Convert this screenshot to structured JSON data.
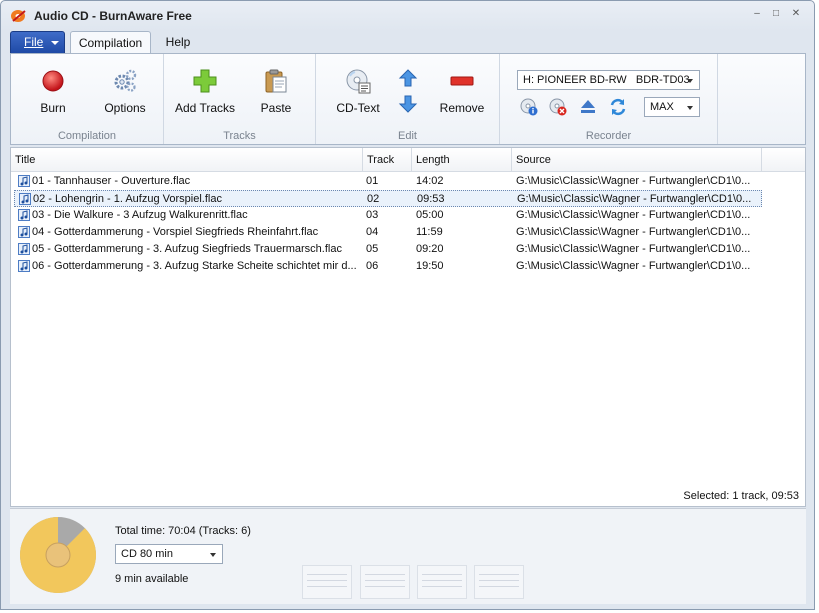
{
  "window": {
    "title": "Audio CD - BurnAware Free"
  },
  "tabs": {
    "file": "File",
    "items": [
      "Compilation",
      "Help"
    ]
  },
  "ribbon": {
    "groups": {
      "compilation": {
        "label": "Compilation",
        "burn": "Burn",
        "options": "Options"
      },
      "tracks": {
        "label": "Tracks",
        "add": "Add Tracks",
        "paste": "Paste"
      },
      "edit": {
        "label": "Edit",
        "cdtext": "CD-Text",
        "remove": "Remove"
      },
      "recorder": {
        "label": "Recorder",
        "drive": "H: PIONEER BD-RW   BDR-TD03",
        "speed": "MAX"
      }
    }
  },
  "columns": {
    "title": "Title",
    "track": "Track",
    "length": "Length",
    "source": "Source"
  },
  "rows": [
    {
      "title": "01 - Tannhauser - Ouverture.flac",
      "track": "01",
      "length": "14:02",
      "source": "G:\\Music\\Classic\\Wagner - Furtwangler\\CD1\\0..."
    },
    {
      "title": "02 - Lohengrin - 1. Aufzug Vorspiel.flac",
      "track": "02",
      "length": "09:53",
      "source": "G:\\Music\\Classic\\Wagner - Furtwangler\\CD1\\0..."
    },
    {
      "title": "03 - Die Walkure - 3 Aufzug Walkurenritt.flac",
      "track": "03",
      "length": "05:00",
      "source": "G:\\Music\\Classic\\Wagner - Furtwangler\\CD1\\0..."
    },
    {
      "title": "04 - Gotterdammerung - Vorspiel Siegfrieds Rheinfahrt.flac",
      "track": "04",
      "length": "11:59",
      "source": "G:\\Music\\Classic\\Wagner - Furtwangler\\CD1\\0..."
    },
    {
      "title": "05 - Gotterdammerung - 3. Aufzug Siegfrieds Trauermarsch.flac",
      "track": "05",
      "length": "09:20",
      "source": "G:\\Music\\Classic\\Wagner - Furtwangler\\CD1\\0..."
    },
    {
      "title": "06 - Gotterdammerung - 3. Aufzug Starke Scheite schichtet mir d...",
      "track": "06",
      "length": "19:50",
      "source": "G:\\Music\\Classic\\Wagner - Furtwangler\\CD1\\0..."
    }
  ],
  "selected_row": 1,
  "status": {
    "selected": "Selected: 1 track, 09:53"
  },
  "summary": {
    "total": "Total time: 70:04 (Tracks: 6)",
    "disc": "CD 80 min",
    "available": "9 min available",
    "used_fraction": 0.875
  },
  "colors": {
    "accent": "#2a56b8",
    "used": "#f2c75c",
    "free": "#a9a9a9"
  },
  "icons": [
    "app-icon",
    "burn-icon",
    "options-icon",
    "add-tracks-icon",
    "paste-icon",
    "cd-text-icon",
    "move-up-icon",
    "move-down-icon",
    "remove-icon",
    "disc-info-icon",
    "erase-icon",
    "eject-icon",
    "refresh-icon",
    "music-file-icon"
  ]
}
